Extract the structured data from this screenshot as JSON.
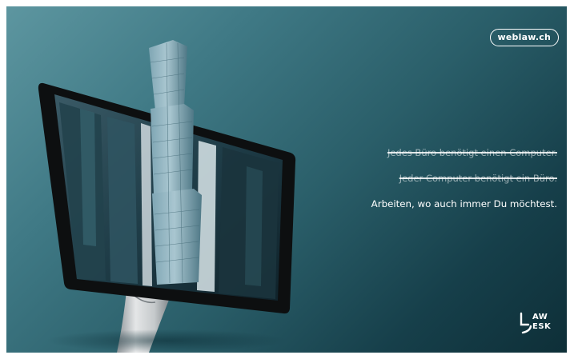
{
  "badge": {
    "text": "weblaw.ch"
  },
  "taglines": {
    "line1": "Jedes Büro benötigt einen Computer.",
    "line2": "Jeder Computer benötigt ein Büro.",
    "line3": "Arbeiten, wo auch immer Du möchtest."
  },
  "logo": {
    "line1": "AW",
    "line2": "ESK"
  },
  "colors": {
    "background_light": "#5d96a0",
    "background_dark": "#0e2f38",
    "text": "#ffffff",
    "monitor_frame": "#0d0f10",
    "stand": "#c9cdd0"
  },
  "icons": [
    "monitor-illustration",
    "skyscraper-illustration",
    "law-desk-logo-icon"
  ]
}
